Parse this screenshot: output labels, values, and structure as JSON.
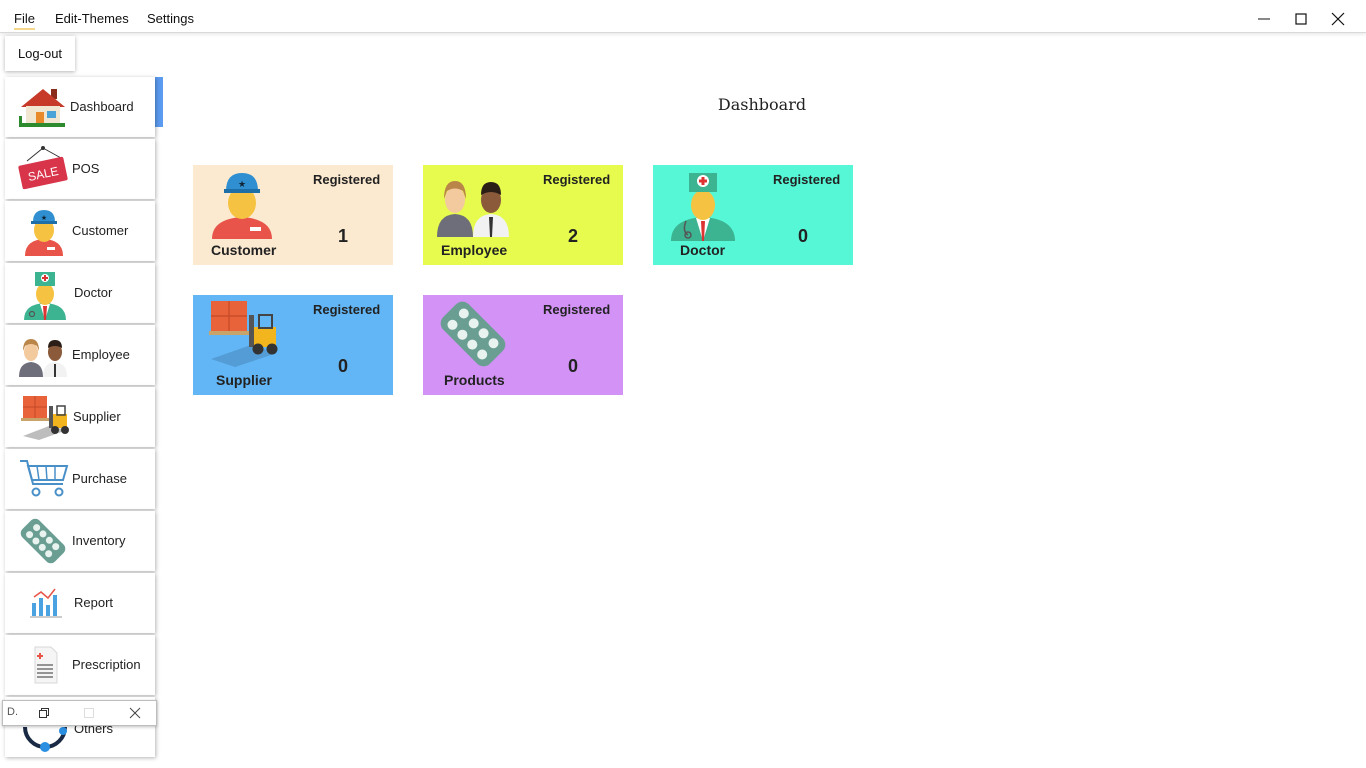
{
  "menu": {
    "file": "File",
    "edit_themes": "Edit-Themes",
    "settings": "Settings",
    "file_dropdown": [
      "Log-out"
    ]
  },
  "window_controls": [
    "minimize-icon",
    "maximize-icon",
    "close-icon"
  ],
  "sidebar": {
    "items": [
      {
        "label": "Dashboard",
        "icon": "house-icon",
        "active": true
      },
      {
        "label": "POS",
        "icon": "sale-tag-icon"
      },
      {
        "label": "Customer",
        "icon": "customer-icon"
      },
      {
        "label": "Doctor",
        "icon": "doctor-icon"
      },
      {
        "label": "Employee",
        "icon": "employees-icon"
      },
      {
        "label": "Supplier",
        "icon": "forklift-icon"
      },
      {
        "label": "Purchase",
        "icon": "cart-icon"
      },
      {
        "label": "Inventory",
        "icon": "pill-pack-icon"
      },
      {
        "label": "Report",
        "icon": "chart-icon"
      },
      {
        "label": "Prescription",
        "icon": "prescription-icon"
      },
      {
        "label": "Others",
        "icon": "others-icon"
      }
    ]
  },
  "mini_window": {
    "title": "D.",
    "icons": [
      "restore-icon",
      "maximize-icon",
      "close-icon"
    ]
  },
  "main": {
    "title": "Dashboard",
    "cards": [
      {
        "name": "Customer",
        "label": "Registered",
        "count": "1",
        "color": "#fbe9d0",
        "icon": "customer-icon"
      },
      {
        "name": "Employee",
        "label": "Registered",
        "count": "2",
        "color": "#e6fb4d",
        "icon": "employees-icon"
      },
      {
        "name": "Doctor",
        "label": "Registered",
        "count": "0",
        "color": "#56f7d6",
        "icon": "doctor-icon"
      },
      {
        "name": "Supplier",
        "label": "Registered",
        "count": "0",
        "color": "#62b6f5",
        "icon": "forklift-icon"
      },
      {
        "name": "Products",
        "label": "Registered",
        "count": "0",
        "color": "#d392f6",
        "icon": "pill-pack-icon"
      }
    ]
  },
  "colors": {
    "active_indicator": "#5b9bf0"
  }
}
